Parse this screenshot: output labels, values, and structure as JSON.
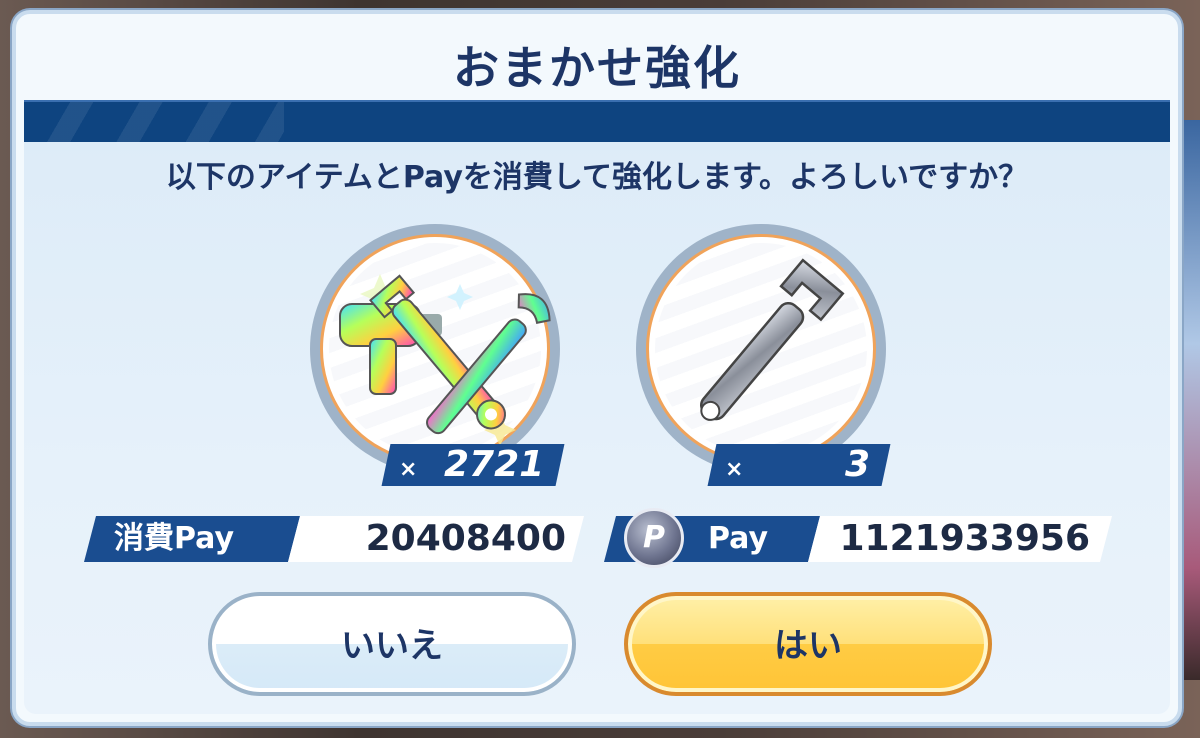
{
  "dialog": {
    "title": "おまかせ強化",
    "message": "以下のアイテムとPayを消費して強化します。よろしいですか？"
  },
  "items": [
    {
      "name": "tool-set",
      "count_prefix": "×",
      "count": "2721"
    },
    {
      "name": "wrench",
      "count_prefix": "×",
      "count": "3"
    }
  ],
  "cost": {
    "label": "消費Pay",
    "value": "20408400"
  },
  "balance": {
    "coin_glyph": "P",
    "label": "Pay",
    "value": "1121933956"
  },
  "buttons": {
    "no_label": "いいえ",
    "yes_label": "はい"
  },
  "colors": {
    "accent_blue": "#1a4d90",
    "title_text": "#1d3566",
    "yes_button": "#ffcc44",
    "yes_border": "#d98a2e",
    "ring_orange": "#f0a35a"
  }
}
